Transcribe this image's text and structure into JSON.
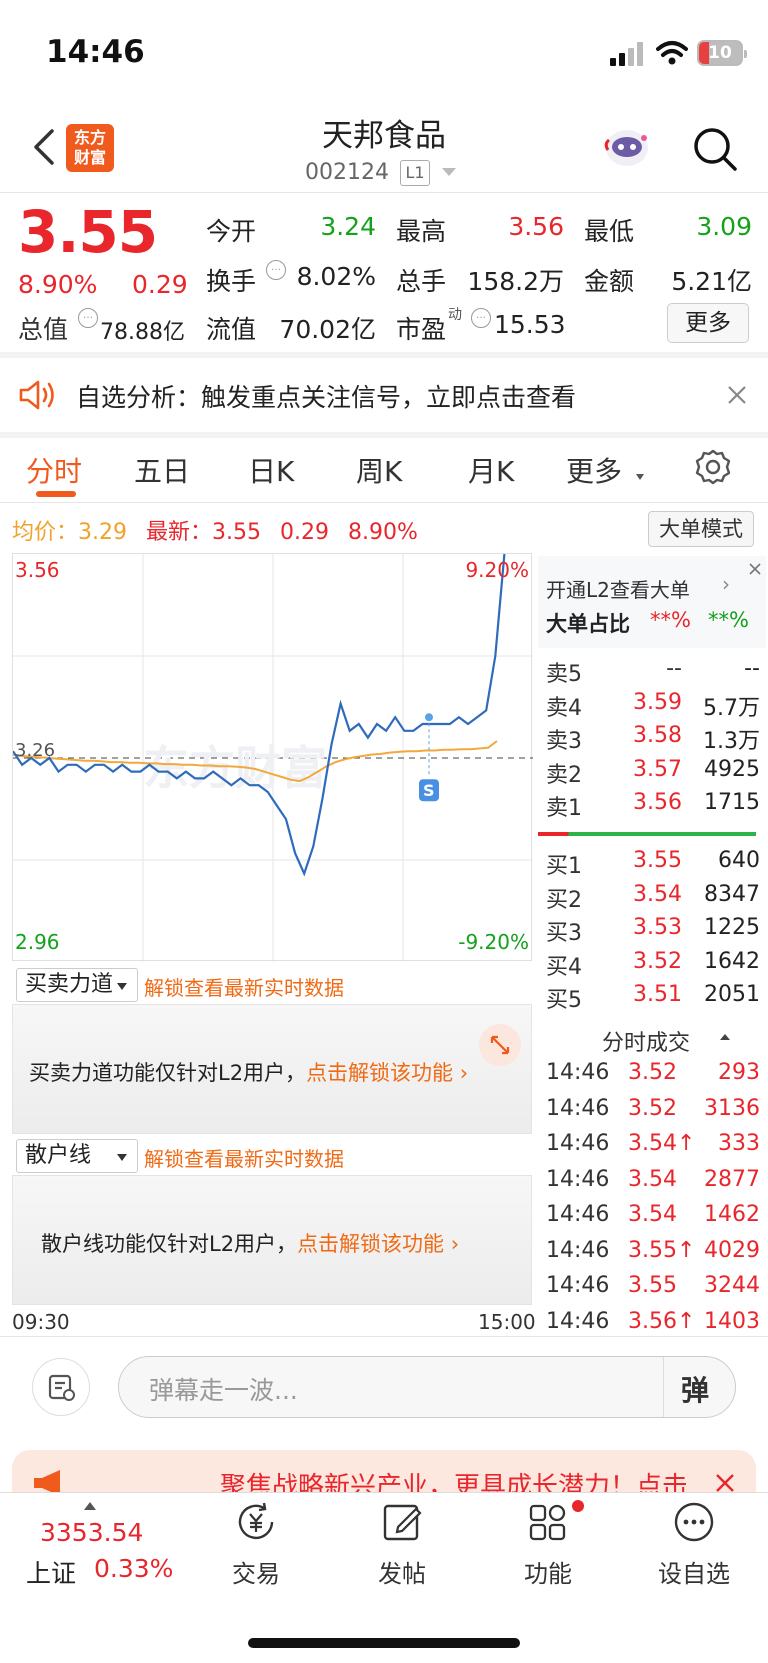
{
  "status_bar": {
    "time": "14:46",
    "battery": "10"
  },
  "header": {
    "logo_line1": "东方",
    "logo_line2": "财富",
    "title": "天邦食品",
    "code": "002124",
    "level": "L1"
  },
  "quote": {
    "price": "3.55",
    "change_pct": "8.90%",
    "change_amt": "0.29",
    "open_label": "今开",
    "open": "3.24",
    "high_label": "最高",
    "high": "3.56",
    "low_label": "最低",
    "low": "3.09",
    "turnover_label": "换手",
    "turnover": "8.02%",
    "volume_label": "总手",
    "volume": "158.2万",
    "amount_label": "金额",
    "amount": "5.21亿",
    "mktcap_label": "总值",
    "mktcap": "78.88亿",
    "float_label": "流值",
    "float": "70.02亿",
    "pe_label": "市盈",
    "pe_sup": "动",
    "pe": "15.53",
    "more_label": "更多"
  },
  "notice": {
    "text": "自选分析：触发重点关注信号，立即点击查看"
  },
  "tabs": [
    "分时",
    "五日",
    "日K",
    "周K",
    "月K",
    "更多"
  ],
  "active_tab": "分时",
  "avg_bar": {
    "avg_label": "均价：",
    "avg": "3.29",
    "last_label": "最新：",
    "last": "3.55",
    "chg": "0.29",
    "pct": "8.90%",
    "big_order_btn": "大单模式"
  },
  "chart_data": {
    "type": "line",
    "y_top": "3.56",
    "y_mid": "3.26",
    "y_bottom": "2.96",
    "pct_top": "9.20%",
    "pct_bottom": "-9.20%",
    "x_start": "09:30",
    "x_end": "15:00",
    "ylim": [
      2.96,
      3.56
    ],
    "watermark": "东方财富",
    "signal_marker": "S",
    "series": [
      {
        "values": [
          3.27,
          3.25,
          3.26,
          3.25,
          3.26,
          3.24,
          3.25,
          3.25,
          3.24,
          3.25,
          3.25,
          3.24,
          3.25,
          3.24,
          3.24,
          3.25,
          3.24,
          3.24,
          3.23,
          3.24,
          3.23,
          3.23,
          3.24,
          3.23,
          3.22,
          3.23,
          3.22,
          3.22,
          3.21,
          3.19,
          3.17,
          3.12,
          3.09,
          3.13,
          3.2,
          3.28,
          3.34,
          3.3,
          3.31,
          3.29,
          3.31,
          3.3,
          3.32,
          3.3,
          3.3,
          3.31,
          3.31,
          3.31,
          3.31,
          3.32,
          3.31,
          3.32,
          3.33,
          3.41,
          3.56
        ]
      },
      {
        "values": [
          3.265,
          3.263,
          3.262,
          3.261,
          3.26,
          3.259,
          3.258,
          3.257,
          3.256,
          3.256,
          3.255,
          3.254,
          3.254,
          3.253,
          3.253,
          3.252,
          3.252,
          3.251,
          3.251,
          3.25,
          3.25,
          3.249,
          3.249,
          3.248,
          3.248,
          3.247,
          3.246,
          3.244,
          3.24,
          3.236,
          3.232,
          3.228,
          3.226,
          3.232,
          3.24,
          3.248,
          3.254,
          3.258,
          3.261,
          3.263,
          3.265,
          3.266,
          3.268,
          3.269,
          3.27,
          3.27,
          3.271,
          3.271,
          3.272,
          3.272,
          3.273,
          3.273,
          3.274,
          3.275,
          3.285
        ]
      }
    ]
  },
  "l2": {
    "open_text": "开通L2查看大单",
    "ratio_label": "大单占比",
    "ratio_red": "**%",
    "ratio_green": "**%"
  },
  "order_book": {
    "asks": [
      {
        "label": "卖5",
        "price": "--",
        "vol": "--"
      },
      {
        "label": "卖4",
        "price": "3.59",
        "vol": "5.7万"
      },
      {
        "label": "卖3",
        "price": "3.58",
        "vol": "1.3万"
      },
      {
        "label": "卖2",
        "price": "3.57",
        "vol": "4925"
      },
      {
        "label": "卖1",
        "price": "3.56",
        "vol": "1715"
      }
    ],
    "bids": [
      {
        "label": "买1",
        "price": "3.55",
        "vol": "640"
      },
      {
        "label": "买2",
        "price": "3.54",
        "vol": "8347"
      },
      {
        "label": "买3",
        "price": "3.53",
        "vol": "1225"
      },
      {
        "label": "买4",
        "price": "3.52",
        "vol": "1642"
      },
      {
        "label": "买5",
        "price": "3.51",
        "vol": "2051"
      }
    ]
  },
  "ticks_title": "分时成交",
  "ticks": [
    {
      "time": "14:46",
      "price": "3.52",
      "vol": "293"
    },
    {
      "time": "14:46",
      "price": "3.52",
      "vol": "3136"
    },
    {
      "time": "14:46",
      "price": "3.54↑",
      "vol": "333"
    },
    {
      "time": "14:46",
      "price": "3.54",
      "vol": "2877"
    },
    {
      "time": "14:46",
      "price": "3.54",
      "vol": "1462"
    },
    {
      "time": "14:46",
      "price": "3.55↑",
      "vol": "4029"
    },
    {
      "time": "14:46",
      "price": "3.55",
      "vol": "3244"
    },
    {
      "time": "14:46",
      "price": "3.56↑",
      "vol": "1403"
    }
  ],
  "panel1": {
    "select": "买卖力道",
    "unlock": "解锁查看最新实时数据",
    "msg": "买卖力道功能仅针对L2用户，",
    "link": "点击解锁该功能"
  },
  "panel2": {
    "select": "散户线",
    "unlock": "解锁查看最新实时数据",
    "msg": "散户线功能仅针对L2用户，",
    "link": "点击解锁该功能"
  },
  "danmu": {
    "placeholder": "弹幕走一波...",
    "send": "弹"
  },
  "banner": {
    "text": "聚焦战略新兴产业，更具成长潜力！点击"
  },
  "bottom_nav": {
    "index_value": "3353.54",
    "index_name": "上证",
    "index_pct": "0.33%",
    "trade": "交易",
    "post": "发帖",
    "func": "功能",
    "watch": "设自选"
  },
  "colors": {
    "up": "#e8262b",
    "down": "#14a11c",
    "brand": "#f05a1c",
    "price_line": "#2f6bbd",
    "avg_line": "#f2a93b"
  }
}
